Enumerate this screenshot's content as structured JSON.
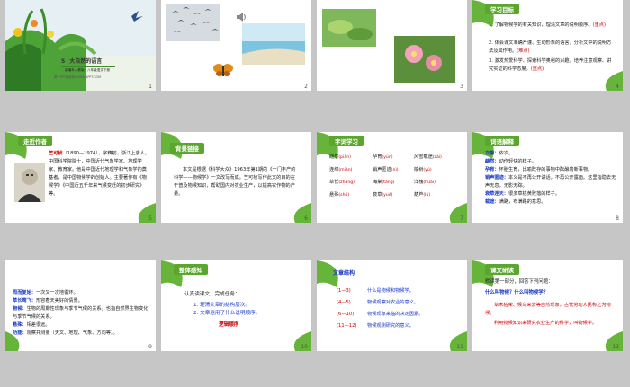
{
  "slides": [
    {
      "num": "1",
      "lesson_num": "5",
      "title": "大自然的语言",
      "sub": "部编本人教版 · 八年级语文下册",
      "footer": "第一PPT模板网-WWW.1PPT.COM"
    },
    {
      "num": "2"
    },
    {
      "num": "3"
    },
    {
      "num": "4",
      "tag": "学习目标",
      "items": [
        "1. 了解物候学的有关知识，理清文章的说明顺序。",
        "(重点)",
        "2. 体会课文准确严谨、生动形象的语言，分析文中的说明方法及其作用。",
        "(难点)",
        "3. 激发热爱科学、探索科学奥秘的兴趣，培养注意观察、讲究实证的科学态度。",
        "(重点)"
      ]
    },
    {
      "num": "5",
      "tag": "走近作者",
      "name": "竺可桢",
      "bio": "（1890—1974），字藕舫，浙江上虞人。中国科学院院士，中国近代气象学家、地理学家、教育家。他是中国近代地理学和气象学的奠基者，是中国物候学的创始人。主要著作有《物候学》《中国近五千年来气候变迁的初步研究》等。"
    },
    {
      "num": "6",
      "tag": "背景链接",
      "text": "本文是根据《科学大众》1963年第1期的《一门丰产的科学——物候学》一文改写而成。竺可桢写作此文的目的在于普及物候知识，帮助国内对农业生产，以提高农作物的产量。"
    },
    {
      "num": "7",
      "tag": "字词学习",
      "rows": [
        [
          {
            "w": "翩然",
            "p": "(piān)"
          },
          {
            "w": "孕育",
            "p": "(yùn)"
          },
          {
            "w": "风雪载途",
            "p": "(zài)"
          }
        ],
        [
          {
            "w": "连绵",
            "p": "(mián)"
          },
          {
            "w": "销声匿迹",
            "p": "(nì)"
          },
          {
            "w": "榆树",
            "p": "(yú)"
          }
        ],
        [
          {
            "w": "草长",
            "p": "(zhǎng)"
          },
          {
            "w": "海棠",
            "p": "(táng)"
          },
          {
            "w": "洋槐",
            "p": "(huái)"
          }
        ],
        [
          {
            "w": "悬殊",
            "p": "(shū)"
          },
          {
            "w": "衰草",
            "p": "(yuè)"
          },
          {
            "w": "葫芦",
            "p": "(lú)"
          }
        ]
      ]
    },
    {
      "num": "8",
      "tag": "词语解释",
      "defs": [
        {
          "k": "次第：",
          "v": "依次。"
        },
        {
          "k": "翩然：",
          "v": "动作轻快的样子。"
        },
        {
          "k": "孕育：",
          "v": "怀胎生育，比喻既存的事物中酝酿着新事物。"
        },
        {
          "k": "销声匿迹：",
          "v": "本义是不再公开讲话，不再公开露面。这里指隐去无声无息，无影无踪。"
        },
        {
          "k": "衰草连天：",
          "v": "很多草枯黄败落的样子。"
        },
        {
          "k": "载途：",
          "v": "满路，布满路的意思。"
        }
      ]
    },
    {
      "num": "9",
      "defs": [
        {
          "k": "周而复始：",
          "v": "一次又一次地循环。"
        },
        {
          "k": "草长莺飞：",
          "v": "形容春天美好的情景。"
        },
        {
          "k": "物候：",
          "v": "生物的周期性现象与季节气候的关系。也指自然界生物变化与季节气候的关系。"
        },
        {
          "k": "悬殊：",
          "v": "相差很远。"
        },
        {
          "k": "功能：",
          "v": "观察并测量（天文、地理、气象、方向等）。"
        }
      ]
    },
    {
      "num": "10",
      "tag": "整体感知",
      "task": "认真读课文，完成任务：",
      "q1": "1. 理清文章的结构层次。",
      "q2": "2. 文章运用了什么说明顺序。",
      "answer": "逻辑顺序"
    },
    {
      "num": "11",
      "heading": "文章结构",
      "rows": [
        {
          "r": "(1—3)",
          "t": "什么是物候和物候学。"
        },
        {
          "r": "(4—5)",
          "t": "物候观察对农业的意义。"
        },
        {
          "r": "(6—10)",
          "t": "物候现象来临的决定因素。"
        },
        {
          "r": "(11—12)",
          "t": "物候观测研究的意义。"
        }
      ]
    },
    {
      "num": "12",
      "tag": "课文研读",
      "q": "默读第一部分，回答下列问题：",
      "sq": "什么叫物候？什么叫物候学？",
      "a1": "草木枯荣、候鸟来去等自然现象，古代劳动人民称之为物候。",
      "a2": "利用物候知识来研究农业生产的科学，叫物候学。"
    }
  ]
}
